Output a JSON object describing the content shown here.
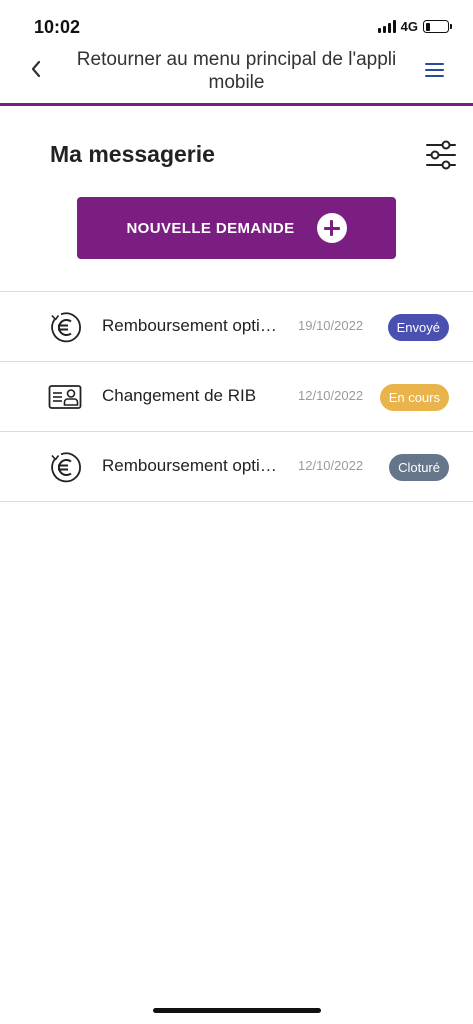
{
  "status_bar": {
    "time": "10:02",
    "network": "4G",
    "battery_level": 0.2
  },
  "header": {
    "back_icon": "chevron-left-icon",
    "title": "Retourner au menu principal de l'appli mobile",
    "menu_icon": "hamburger-menu-icon"
  },
  "page": {
    "title": "Ma messagerie",
    "filter_icon": "sliders-icon"
  },
  "new_request": {
    "label": "NOUVELLE DEMANDE",
    "icon": "plus-circle-icon"
  },
  "requests": [
    {
      "icon": "euro-refund-icon",
      "subject": "Remboursement optique",
      "date": "19/10/2022",
      "status": "Envoyé",
      "status_color": "#4a50b0"
    },
    {
      "icon": "id-card-icon",
      "subject": "Changement de RIB",
      "date": "12/10/2022",
      "status": "En cours",
      "status_color": "#e9b44c"
    },
    {
      "icon": "euro-refund-icon",
      "subject": "Remboursement optique",
      "date": "12/10/2022",
      "status": "Cloturé",
      "status_color": "#66768a"
    }
  ],
  "colors": {
    "brand": "#7b1e82",
    "menu_icon": "#2c4a9a"
  }
}
